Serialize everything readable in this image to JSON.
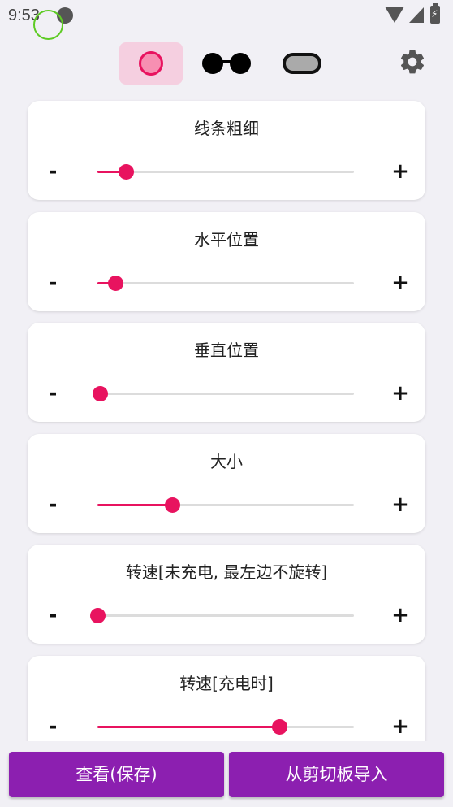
{
  "status_bar": {
    "time": "9:53"
  },
  "toolbar": {
    "modes": [
      {
        "name": "circle-mode",
        "selected": true
      },
      {
        "name": "glasses-mode",
        "selected": false
      },
      {
        "name": "pill-mode",
        "selected": false
      }
    ],
    "settings_icon": "gear-icon"
  },
  "colors": {
    "accent": "#e8135f",
    "button": "#8c1fb0",
    "selected_bg": "#f5cfe0"
  },
  "sliders": [
    {
      "title": "线条粗细",
      "minus": "-",
      "plus": "+",
      "value": 0.11
    },
    {
      "title": "水平位置",
      "minus": "-",
      "plus": "+",
      "value": 0.07
    },
    {
      "title": "垂直位置",
      "minus": "-",
      "plus": "+",
      "value": 0.01
    },
    {
      "title": "大小",
      "minus": "-",
      "plus": "+",
      "value": 0.29
    },
    {
      "title": "转速[未充电, 最左边不旋转]",
      "minus": "-",
      "plus": "+",
      "value": 0.0
    },
    {
      "title": "转速[充电时]",
      "minus": "-",
      "plus": "+",
      "value": 0.71
    }
  ],
  "buttons": {
    "view_save": "查看(保存)",
    "import_clipboard": "从剪切板导入"
  }
}
